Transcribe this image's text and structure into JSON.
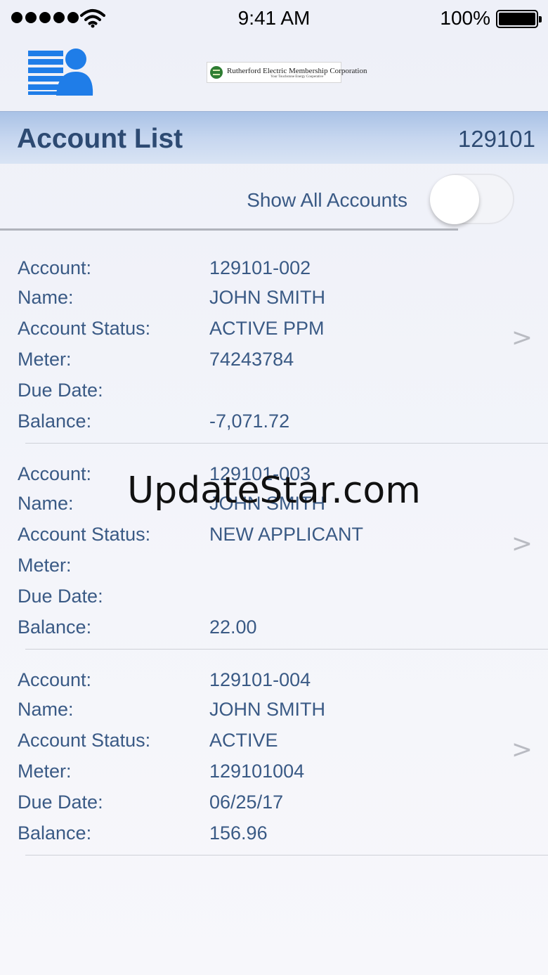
{
  "status_bar": {
    "time": "9:41 AM",
    "battery_percent": "100%",
    "signal_icon": "signal-dots-icon",
    "wifi_icon": "wifi-icon",
    "battery_icon": "battery-icon"
  },
  "header": {
    "menu_icon": "account-list-menu-icon",
    "logo_name": "Rutherford Electric Membership Corporation",
    "logo_tagline": "Your Touchstone Energy Cooperative"
  },
  "title_bar": {
    "title": "Account List",
    "member_number": "129101"
  },
  "toggle": {
    "label": "Show All Accounts",
    "enabled": false
  },
  "accounts": [
    {
      "fields": [
        {
          "label": "Account:",
          "value": "129101-002"
        },
        {
          "label": "Name:",
          "value": "JOHN SMITH"
        },
        {
          "label": "Account Status:",
          "value": "ACTIVE PPM"
        },
        {
          "label": "Meter:",
          "value": "74243784"
        },
        {
          "label": "Due Date:",
          "value": ""
        },
        {
          "label": "Balance:",
          "value": "-7,071.72"
        }
      ],
      "chevron": ">"
    },
    {
      "fields": [
        {
          "label": "Account:",
          "value": "129101-003"
        },
        {
          "label": "Name:",
          "value": "JOHN SMITH"
        },
        {
          "label": "Account Status:",
          "value": "NEW APPLICANT"
        },
        {
          "label": "Meter:",
          "value": ""
        },
        {
          "label": "Due Date:",
          "value": ""
        },
        {
          "label": "Balance:",
          "value": "22.00"
        }
      ],
      "chevron": ">"
    },
    {
      "fields": [
        {
          "label": "Account:",
          "value": "129101-004"
        },
        {
          "label": "Name:",
          "value": "JOHN SMITH"
        },
        {
          "label": "Account Status:",
          "value": "ACTIVE"
        },
        {
          "label": "Meter:",
          "value": "129101004"
        },
        {
          "label": "Due Date:",
          "value": "06/25/17"
        },
        {
          "label": "Balance:",
          "value": "156.96"
        }
      ],
      "chevron": ">"
    }
  ],
  "watermark": "UpdateStar.com",
  "colors": {
    "accent_text": "#3a5a85",
    "title_text": "#2d4a72",
    "menu_icon": "#1f7de8",
    "title_bar": "#c6d6ef"
  }
}
